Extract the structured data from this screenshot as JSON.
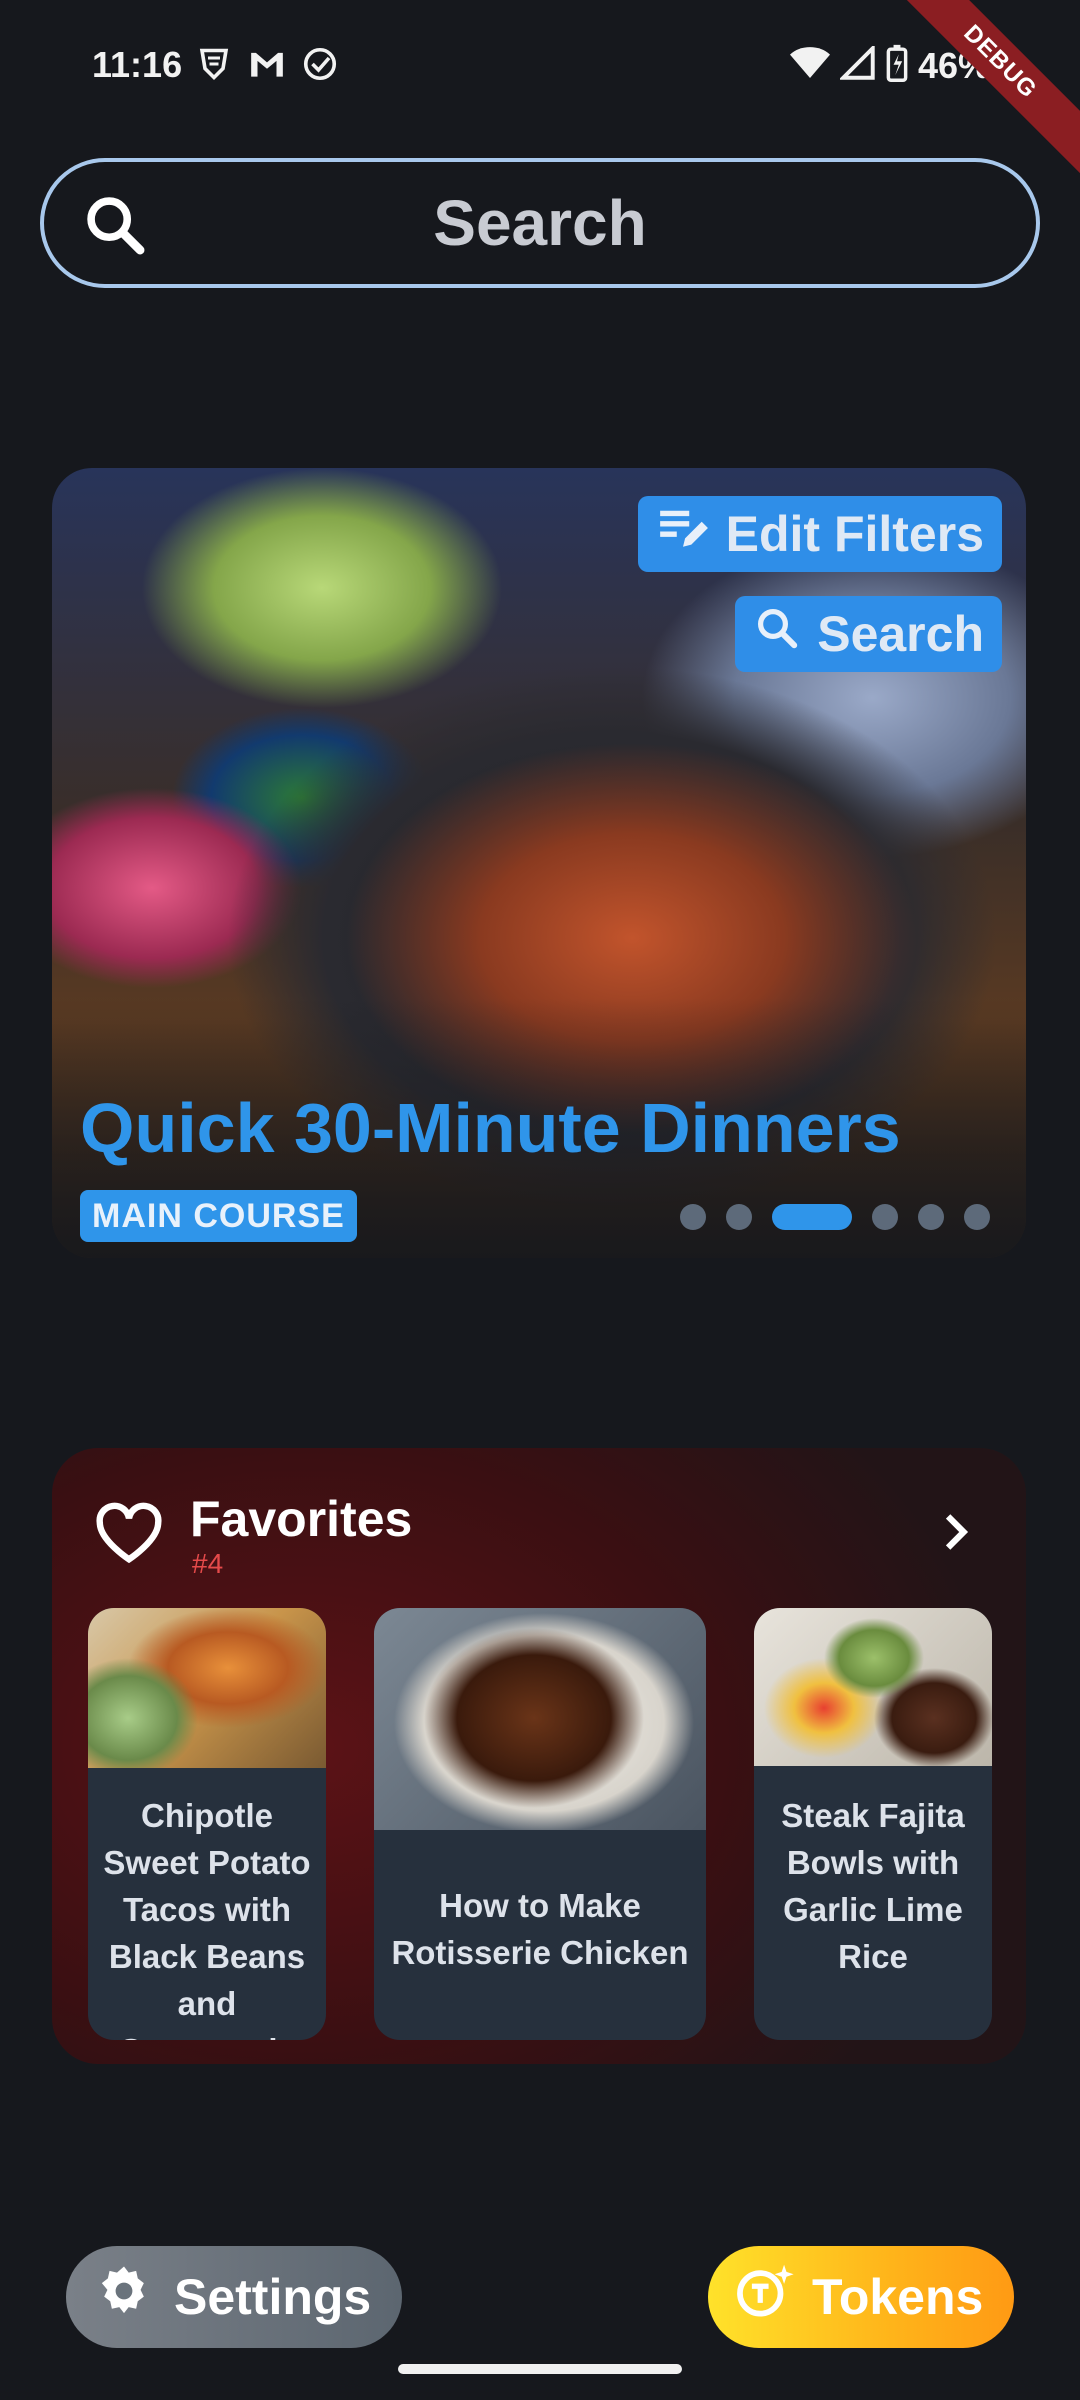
{
  "status_bar": {
    "time": "11:16",
    "battery_percent": "46%",
    "icons": [
      "vpn-shield-icon",
      "gmail-icon",
      "check-circle-icon",
      "wifi-icon",
      "signal-icon",
      "battery-charging-icon"
    ]
  },
  "debug_banner": "DEBUG",
  "search": {
    "label": "Search",
    "icon": "search-icon"
  },
  "hero": {
    "edit_filters_label": "Edit Filters",
    "search_label": "Search",
    "title": "Quick 30-Minute Dinners",
    "tag": "MAIN COURSE",
    "page_count": 6,
    "active_page": 3
  },
  "favorites": {
    "title": "Favorites",
    "rank": "#4",
    "recipes": [
      {
        "title": "Chipotle Sweet Potato Tacos with Black Beans and Guacamole"
      },
      {
        "title": "How to Make Rotisserie Chicken"
      },
      {
        "title": "Steak Fajita Bowls with Garlic Lime Rice"
      }
    ]
  },
  "bottom": {
    "settings_label": "Settings",
    "tokens_label": "Tokens"
  },
  "colors": {
    "accent_blue": "#2f95ea",
    "favorites_bg": "#3a0f12",
    "tokens_gold": "#ffc21a"
  }
}
